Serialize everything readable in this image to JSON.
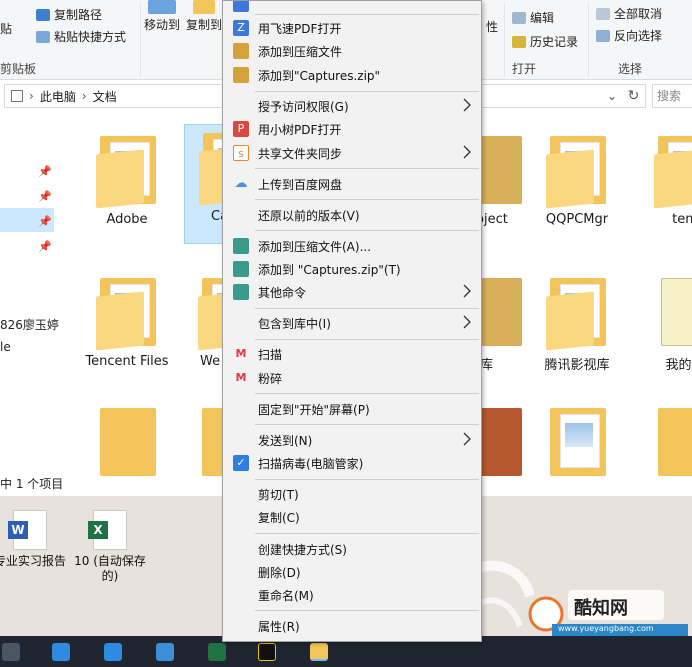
{
  "ribbon": {
    "groups": [
      "剪贴板",
      "打开",
      "选择"
    ],
    "items": {
      "copy_path": "复制路径",
      "paste_shortcut": "粘贴快捷方式",
      "paste_partial": "贴",
      "move_to": "移动到",
      "copy_to": "复制到",
      "edit": "编辑",
      "history": "历史记录",
      "select_all": "全部取消",
      "invert": "反向选择",
      "properties_partial": "性"
    }
  },
  "address": {
    "segments": [
      "此电脑",
      "文档"
    ],
    "search_placeholder": "搜索"
  },
  "navpane": {
    "fragment_1": "826廖玉婷",
    "fragment_2": "le"
  },
  "folders": [
    {
      "label": "Adobe"
    },
    {
      "label": "Ca"
    },
    {
      "label": "oject"
    },
    {
      "label": "QQPCMgr"
    },
    {
      "label": "tem"
    },
    {
      "label": "Tencent Files"
    },
    {
      "label": "We"
    },
    {
      "label": "库"
    },
    {
      "label": "腾讯影视库"
    },
    {
      "label": "我的数"
    }
  ],
  "status": {
    "text": "中 1 个项目"
  },
  "desktop_icons": [
    {
      "label": "专业实习报告",
      "badge": "W"
    },
    {
      "label": "10 (自动保存的)",
      "badge": "X"
    }
  ],
  "context_menu": {
    "items": [
      {
        "label": "用飞速PDF打开",
        "icon": "pdf-z-icon",
        "color": "#3e78d8",
        "glyph": "Z"
      },
      {
        "label": "添加到压缩文件",
        "icon": "archive-icon",
        "color": "#d4a23a",
        "glyph": ""
      },
      {
        "label": "添加到\"Captures.zip\"",
        "icon": "archive-icon",
        "color": "#d4a23a",
        "glyph": ""
      },
      {
        "label": "授予访问权限(G)",
        "submenu": true
      },
      {
        "label": "用小树PDF打开",
        "icon": "pdf-tree-icon",
        "color": "#d8493f",
        "glyph": "P"
      },
      {
        "label": "共享文件夹同步",
        "icon": "sync-icon",
        "color": "#e88a2c",
        "glyph": "s",
        "submenu": true
      },
      {
        "label": "上传到百度网盘",
        "icon": "cloud-icon",
        "color": "#4a90e2",
        "glyph": "☁"
      },
      {
        "label": "还原以前的版本(V)"
      },
      {
        "label": "添加到压缩文件(A)...",
        "icon": "archive-icon",
        "color": "#3a9a8c",
        "glyph": ""
      },
      {
        "label": "添加到 \"Captures.zip\"(T)",
        "icon": "archive-icon",
        "color": "#3a9a8c",
        "glyph": ""
      },
      {
        "label": "其他命令",
        "icon": "archive-icon",
        "color": "#3a9a8c",
        "glyph": "",
        "submenu": true
      },
      {
        "label": "包含到库中(I)",
        "submenu": true
      },
      {
        "label": "扫描",
        "icon": "scan-icon",
        "color": "#e0393e",
        "glyph": "M"
      },
      {
        "label": "粉碎",
        "icon": "shred-icon",
        "color": "#e0393e",
        "glyph": "M"
      },
      {
        "label": "固定到\"开始\"屏幕(P)"
      },
      {
        "label": "发送到(N)",
        "submenu": true
      },
      {
        "label": "扫描病毒(电脑管家)",
        "icon": "shield-icon",
        "color": "#2f7de1",
        "glyph": "✓"
      },
      {
        "label": "剪切(T)"
      },
      {
        "label": "复制(C)"
      },
      {
        "label": "创建快捷方式(S)"
      },
      {
        "label": "删除(D)"
      },
      {
        "label": "重命名(M)"
      },
      {
        "label": "属性(R)"
      }
    ]
  },
  "watermark": {
    "text": "酷知网",
    "site": "www.yueyangbang.com"
  },
  "colors": {
    "accent": "#cce8ff",
    "folder": "#f3c45a",
    "taskbar": "#1f2630",
    "menu_bg": "#f2f2f2"
  }
}
